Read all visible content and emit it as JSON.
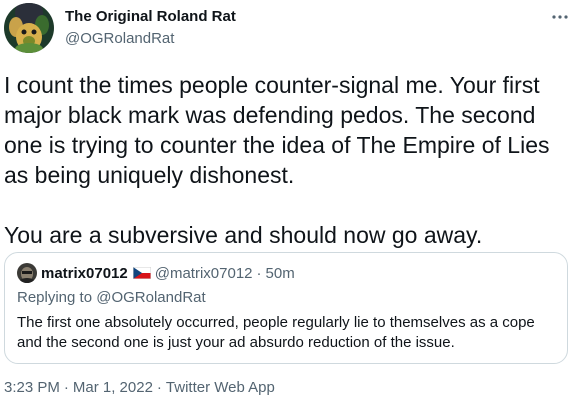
{
  "author": {
    "display_name": "The Original Roland Rat",
    "handle": "@OGRolandRat",
    "avatar_icon": "roland-rat-avatar"
  },
  "more_icon": "more-horizontal-icon",
  "tweet": {
    "paragraphs": [
      "I count the times people counter-signal me. Your first major black mark was defending pedos. The second one is trying to counter the idea of The Empire of Lies as being uniquely dishonest.",
      "You are a subversive and should now go away."
    ]
  },
  "quoted": {
    "display_name": "matrix07012",
    "flag_icon": "czech-flag-icon",
    "handle": "@matrix07012",
    "separator": "·",
    "time": "50m",
    "replying_label": "Replying to",
    "replying_to": "@OGRolandRat",
    "text": "The first one absolutely occurred, people regularly lie to themselves as a cope and the second one is just your ad absurdo reduction of the issue."
  },
  "meta": {
    "time": "3:23 PM",
    "separator": "·",
    "date": "Mar 1, 2022",
    "source": "Twitter Web App"
  },
  "colors": {
    "text": "#0f1419",
    "secondary": "#536471",
    "border": "#cfd9de"
  }
}
